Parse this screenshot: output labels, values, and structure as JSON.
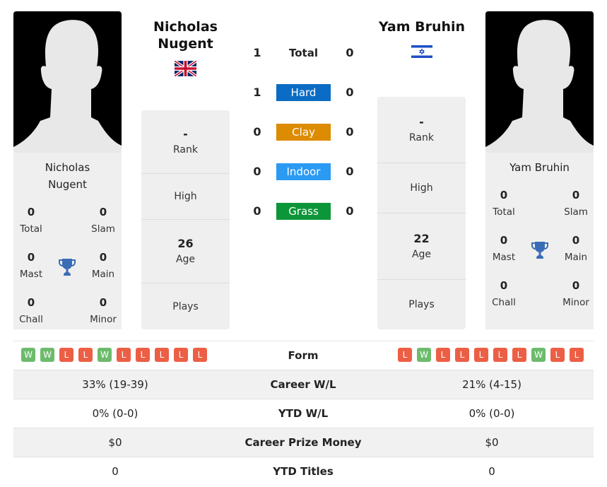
{
  "player1": {
    "name": "Nicholas Nugent",
    "name_line1": "Nicholas",
    "name_line2": "Nugent",
    "country_flag": "uk-flag-icon",
    "titles": {
      "total": {
        "value": "0",
        "label": "Total"
      },
      "slam": {
        "value": "0",
        "label": "Slam"
      },
      "mast": {
        "value": "0",
        "label": "Mast"
      },
      "main": {
        "value": "0",
        "label": "Main"
      },
      "chall": {
        "value": "0",
        "label": "Chall"
      },
      "minor": {
        "value": "0",
        "label": "Minor"
      }
    },
    "panel": {
      "rank": {
        "value": "-",
        "label": "Rank"
      },
      "high": {
        "value": "",
        "label": "High"
      },
      "age": {
        "value": "26",
        "label": "Age"
      },
      "plays": {
        "value": "",
        "label": "Plays"
      }
    },
    "form": [
      "W",
      "W",
      "L",
      "L",
      "W",
      "L",
      "L",
      "L",
      "L",
      "L"
    ]
  },
  "player2": {
    "name": "Yam Bruhin",
    "country_flag": "israel-flag-icon",
    "titles": {
      "total": {
        "value": "0",
        "label": "Total"
      },
      "slam": {
        "value": "0",
        "label": "Slam"
      },
      "mast": {
        "value": "0",
        "label": "Mast"
      },
      "main": {
        "value": "0",
        "label": "Main"
      },
      "chall": {
        "value": "0",
        "label": "Chall"
      },
      "minor": {
        "value": "0",
        "label": "Minor"
      }
    },
    "panel": {
      "rank": {
        "value": "-",
        "label": "Rank"
      },
      "high": {
        "value": "",
        "label": "High"
      },
      "age": {
        "value": "22",
        "label": "Age"
      },
      "plays": {
        "value": "",
        "label": "Plays"
      }
    },
    "form": [
      "L",
      "W",
      "L",
      "L",
      "L",
      "L",
      "L",
      "W",
      "L",
      "L"
    ]
  },
  "h2h": [
    {
      "label": "Total",
      "p1": "1",
      "p2": "0",
      "color": null
    },
    {
      "label": "Hard",
      "p1": "1",
      "p2": "0",
      "color": "#0a6cc4"
    },
    {
      "label": "Clay",
      "p1": "0",
      "p2": "0",
      "color": "#dd8b00"
    },
    {
      "label": "Indoor",
      "p1": "0",
      "p2": "0",
      "color": "#2b9af3"
    },
    {
      "label": "Grass",
      "p1": "0",
      "p2": "0",
      "color": "#0d9639"
    }
  ],
  "form_label": "Form",
  "stats": [
    {
      "label": "Career W/L",
      "p1": "33% (19-39)",
      "p2": "21% (4-15)"
    },
    {
      "label": "YTD W/L",
      "p1": "0% (0-0)",
      "p2": "0% (0-0)"
    },
    {
      "label": "Career Prize Money",
      "p1": "$0",
      "p2": "$0"
    },
    {
      "label": "YTD Titles",
      "p1": "0",
      "p2": "0"
    }
  ],
  "colors": {
    "win": "#6dbb6d",
    "loss": "#ec5f45",
    "trophy": "#3a6db5"
  }
}
